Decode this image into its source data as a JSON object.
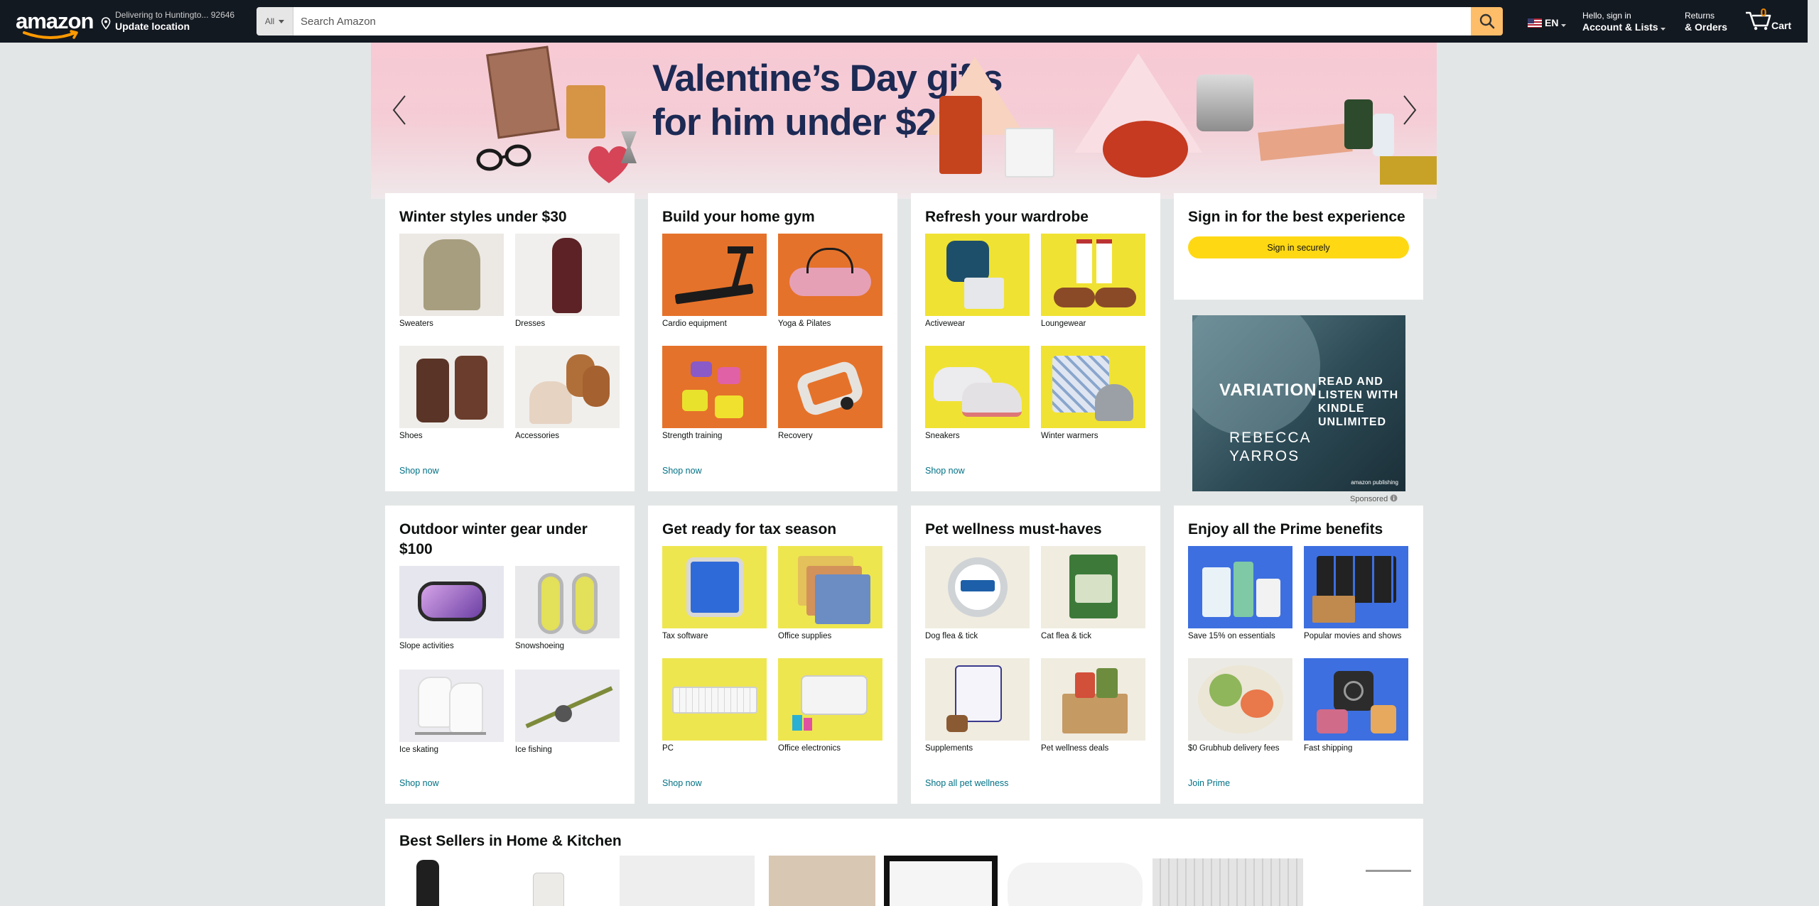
{
  "header": {
    "logo": "amazon",
    "deliver_line1": "Delivering to Huntingto... 92646",
    "deliver_line2": "Update location",
    "search_dept": "All",
    "search_placeholder": "Search Amazon",
    "lang": "EN",
    "account_line1": "Hello, sign in",
    "account_line2": "Account & Lists",
    "orders_line1": "Returns",
    "orders_line2": "& Orders",
    "cart_count": "0",
    "cart_label": "Cart"
  },
  "hero": {
    "line1": "Valentine’s Day gifts",
    "line2": "for him under $20"
  },
  "cards": {
    "winter": {
      "title": "Winter styles under $30",
      "tiles": [
        "Sweaters",
        "Dresses",
        "Shoes",
        "Accessories"
      ],
      "link": "Shop now"
    },
    "gym": {
      "title": "Build your home gym",
      "tiles": [
        "Cardio equipment",
        "Yoga & Pilates",
        "Strength training",
        "Recovery"
      ],
      "link": "Shop now"
    },
    "wardrobe": {
      "title": "Refresh your wardrobe",
      "tiles": [
        "Activewear",
        "Loungewear",
        "Sneakers",
        "Winter warmers"
      ],
      "link": "Shop now"
    },
    "signin": {
      "title": "Sign in for the best experience",
      "button": "Sign in securely"
    },
    "outdoor": {
      "title": "Outdoor winter gear under $100",
      "tiles": [
        "Slope activities",
        "Snowshoeing",
        "Ice skating",
        "Ice fishing"
      ],
      "link": "Shop now"
    },
    "tax": {
      "title": "Get ready for tax season",
      "tiles": [
        "Tax software",
        "Office supplies",
        "PC",
        "Office electronics"
      ],
      "link": "Shop now"
    },
    "pet": {
      "title": "Pet wellness must-haves",
      "tiles": [
        "Dog flea & tick",
        "Cat flea & tick",
        "Supplements",
        "Pet wellness deals"
      ],
      "link": "Shop all pet wellness"
    },
    "prime": {
      "title": "Enjoy all the Prime benefits",
      "tiles": [
        "Save 15% on essentials",
        "Popular movies and shows",
        "$0 Grubhub delivery fees",
        "Fast shipping"
      ],
      "link": "Join Prime"
    }
  },
  "ad": {
    "book_title": "VARIATION",
    "author_first": "REBECCA",
    "author_last": "YARROS",
    "tagline1": "READ AND",
    "tagline2": "LISTEN WITH",
    "tagline3": "KINDLE",
    "tagline4": "UNLIMITED",
    "publisher": "amazon publishing",
    "sponsored": "Sponsored"
  },
  "best_sellers": {
    "title": "Best Sellers in Home & Kitchen"
  },
  "colors": {
    "nav_bg": "#131921",
    "search_button": "#febd69",
    "link": "#007185",
    "signin_button": "#ffd814",
    "page_bg": "#e3e6e6"
  },
  "icons": [
    "location-pin-icon",
    "caret-down-icon",
    "search-icon",
    "us-flag-icon",
    "cart-icon",
    "chevron-left-icon",
    "chevron-right-icon",
    "info-icon"
  ]
}
